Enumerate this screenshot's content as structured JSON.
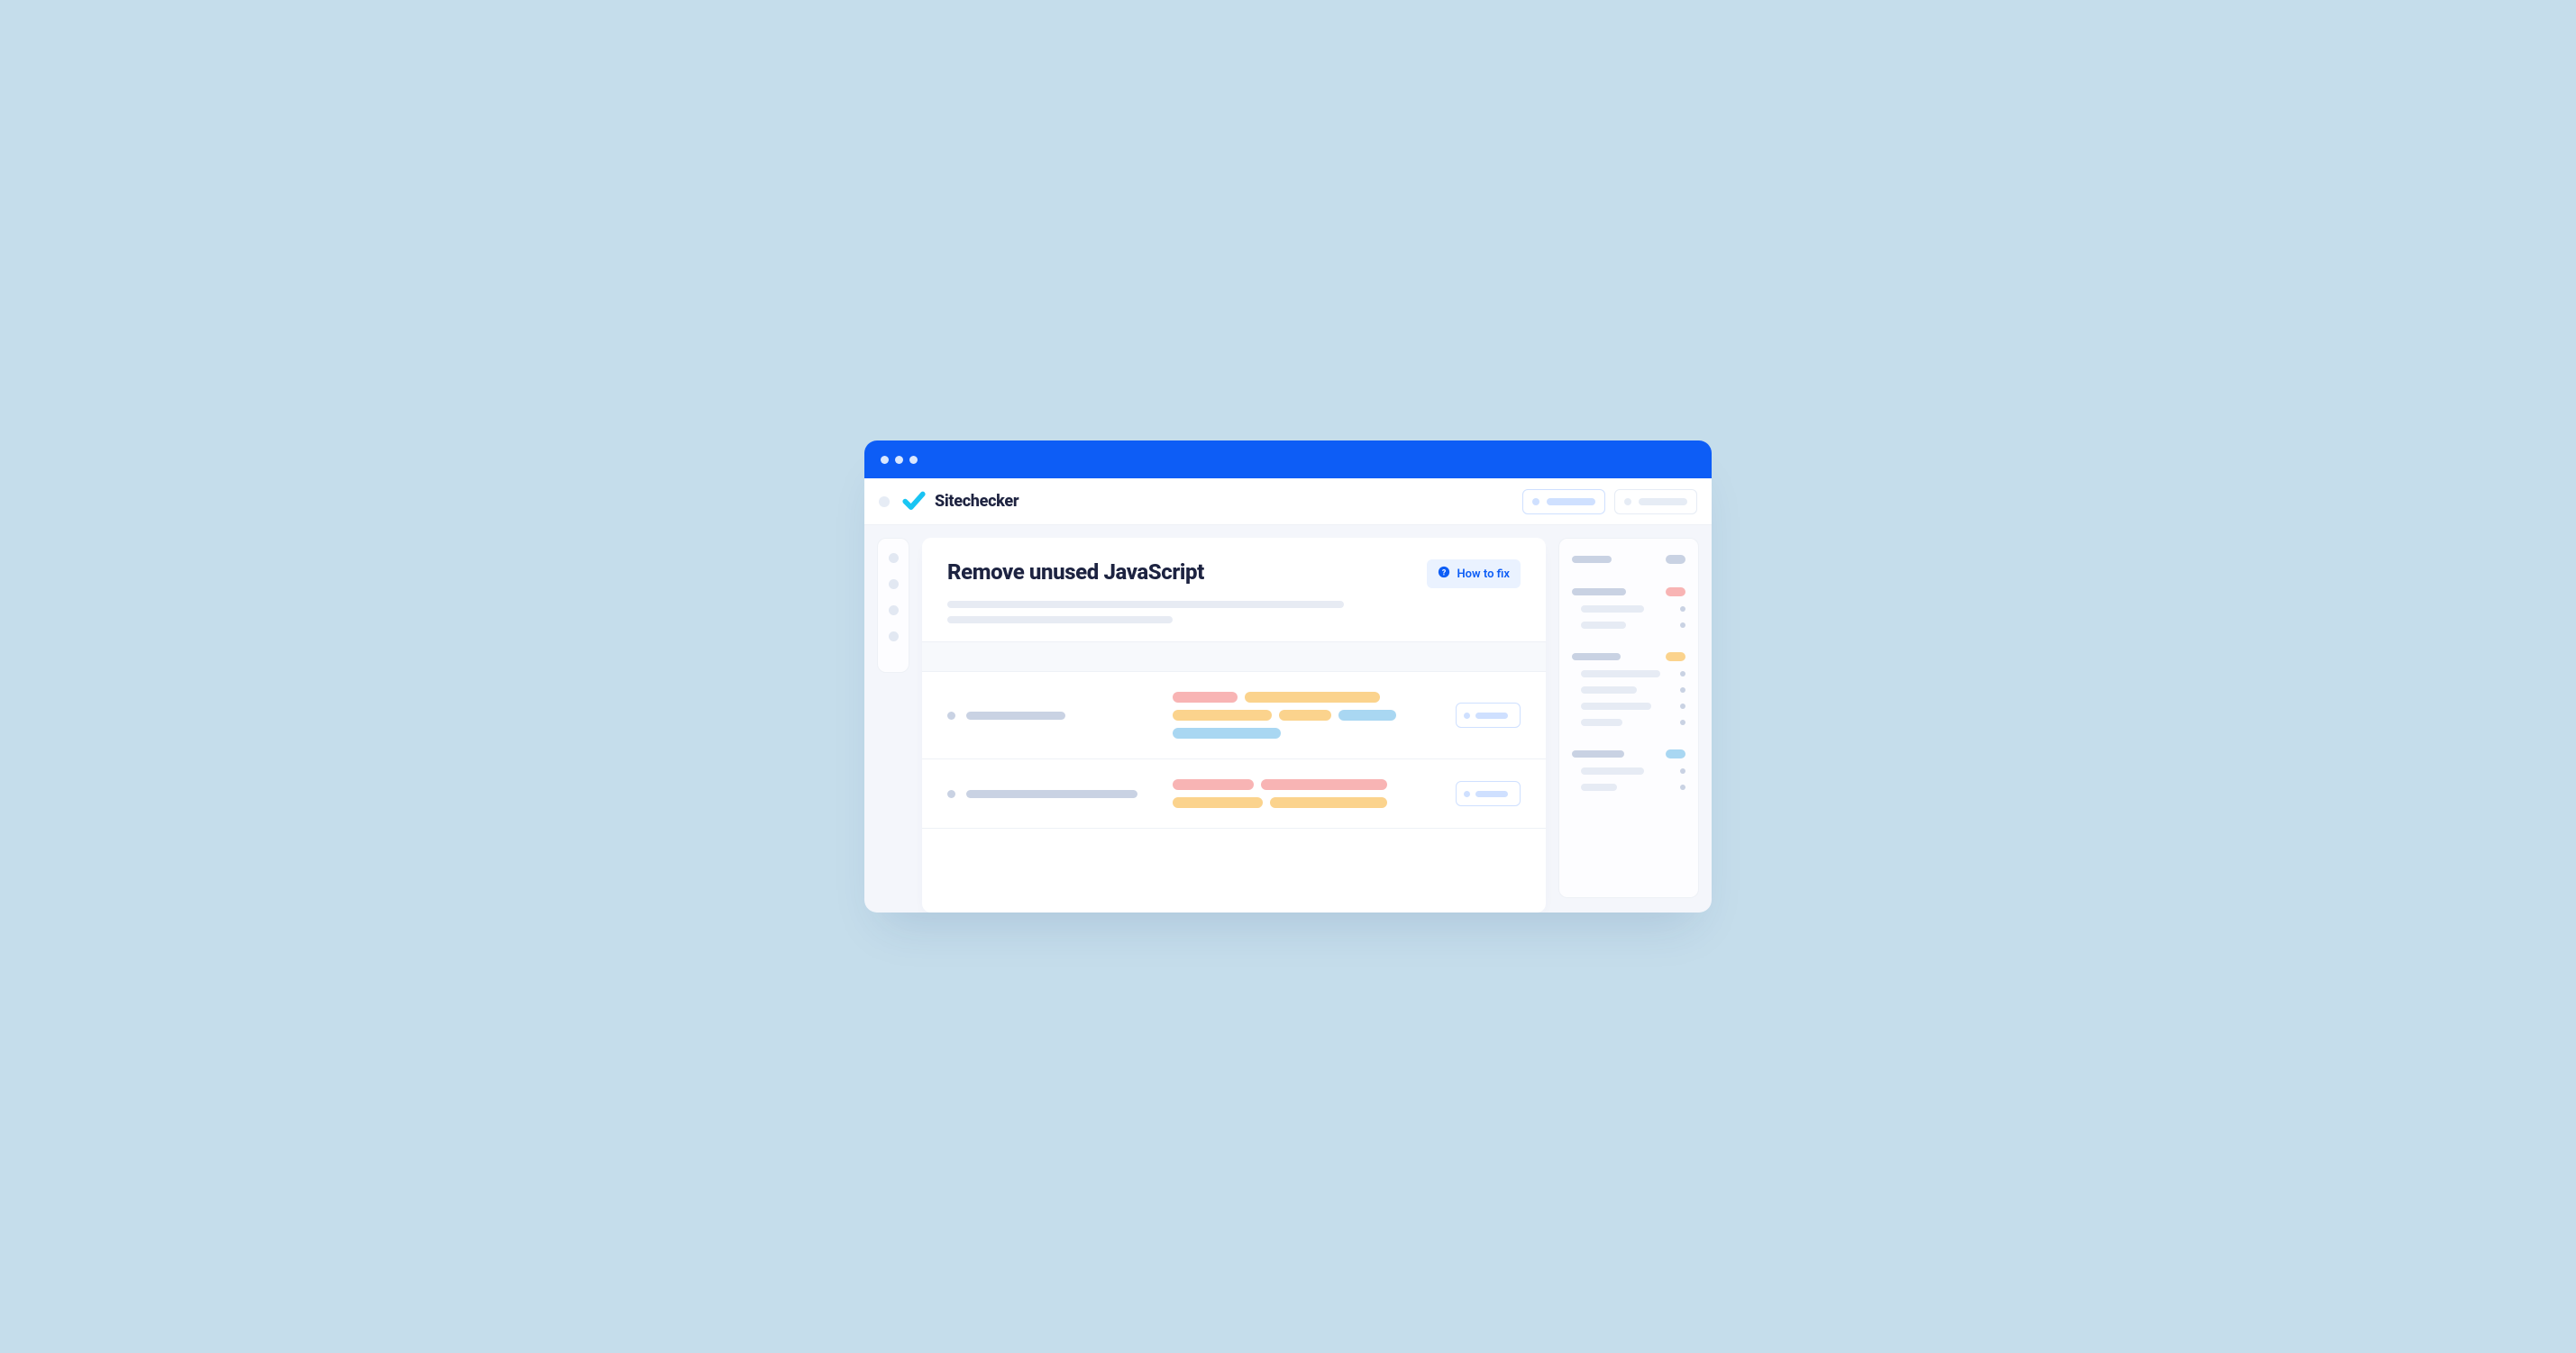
{
  "brand": "Sitechecker",
  "page_title": "Remove unused JavaScript",
  "how_to_fix_label": "How to fix",
  "colors": {
    "accent": "#0d5df6",
    "background": "#c5ddeb",
    "tag_red": "#f8b4b4",
    "tag_orange": "#fbd38d",
    "tag_blue": "#a9d7f2"
  }
}
